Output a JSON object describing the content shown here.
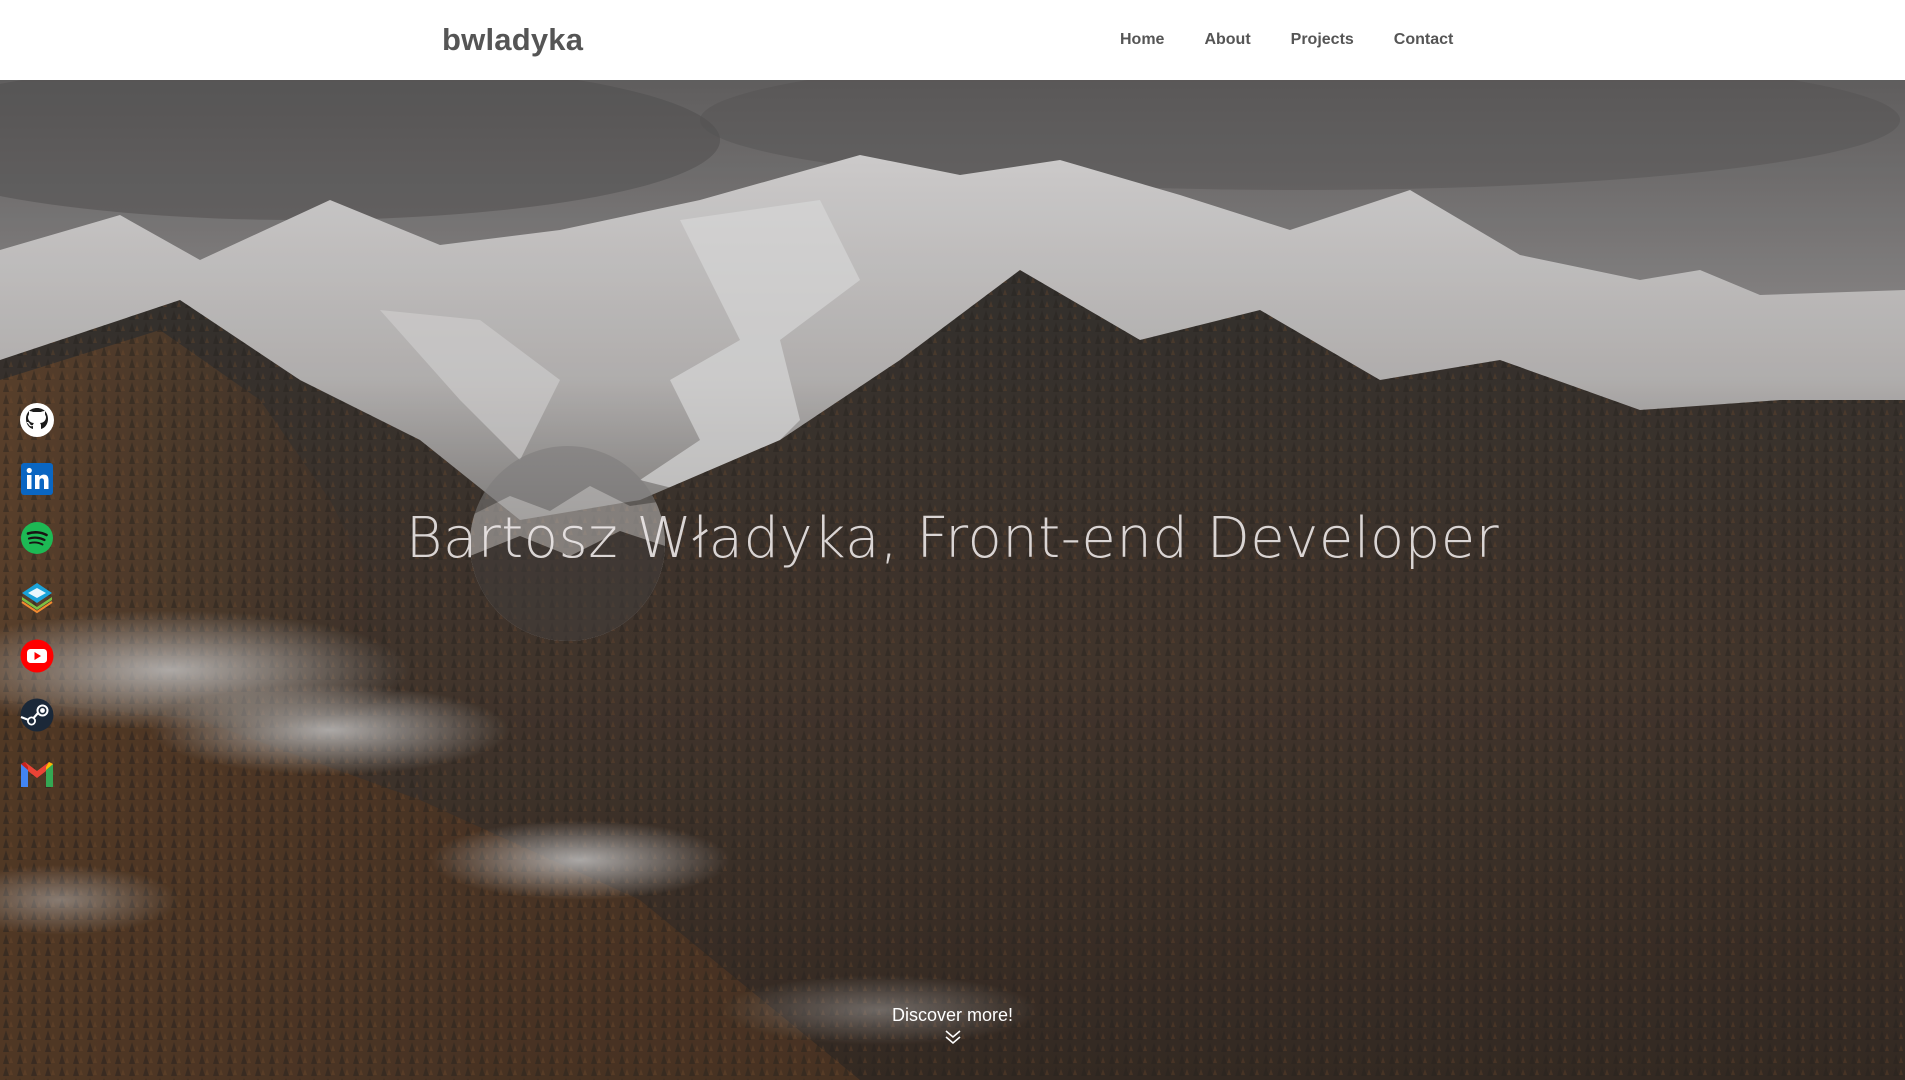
{
  "navbar": {
    "brand": "bwladyka",
    "links": [
      {
        "label": "Home"
      },
      {
        "label": "About"
      },
      {
        "label": "Projects"
      },
      {
        "label": "Contact"
      }
    ]
  },
  "social": [
    {
      "name": "github-icon",
      "color": "#ffffff"
    },
    {
      "name": "linkedin-icon",
      "color": "#0a66c2"
    },
    {
      "name": "spotify-icon",
      "color": "#1db954"
    },
    {
      "name": "stack-icon",
      "color": "#1aa3d9"
    },
    {
      "name": "youtube-icon",
      "color": "#ff0000"
    },
    {
      "name": "steam-icon",
      "color": "#1b2838"
    },
    {
      "name": "gmail-icon",
      "color": "#ea4335"
    }
  ],
  "hero": {
    "headline": "Bartosz Władyka, Front-end Developer",
    "discover": "Discover more!"
  },
  "colors": {
    "nav_text": "#555555",
    "hero_text": "#f0ecec"
  }
}
